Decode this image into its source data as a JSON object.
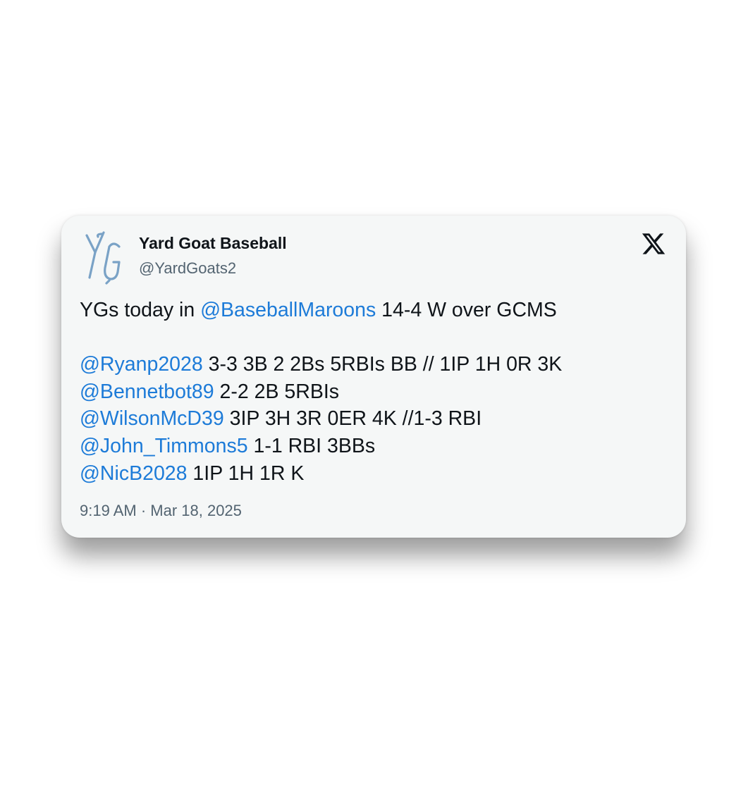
{
  "tweet": {
    "display_name": "Yard Goat Baseball",
    "handle": "@YardGoats2",
    "avatar_icon": "yg-logo",
    "platform_icon": "x-logo-icon",
    "accent_color": "#1d7bd8",
    "lines": [
      {
        "segments": [
          {
            "text": "YGs today in ",
            "mention": false
          },
          {
            "text": "@BaseballMaroons",
            "mention": true
          },
          {
            "text": " 14-4 W over GCMS",
            "mention": false
          }
        ]
      },
      {
        "segments": []
      },
      {
        "segments": [
          {
            "text": "@Ryanp2028",
            "mention": true
          },
          {
            "text": " 3-3 3B 2 2Bs 5RBIs BB // 1IP 1H 0R 3K",
            "mention": false
          }
        ]
      },
      {
        "segments": [
          {
            "text": "@Bennetbot89",
            "mention": true
          },
          {
            "text": " 2-2 2B 5RBIs",
            "mention": false
          }
        ]
      },
      {
        "segments": [
          {
            "text": "@WilsonMcD39",
            "mention": true
          },
          {
            "text": " 3IP 3H 3R 0ER 4K //1-3 RBI",
            "mention": false
          }
        ]
      },
      {
        "segments": [
          {
            "text": "@John_Timmons5",
            "mention": true
          },
          {
            "text": " 1-1 RBI 3BBs",
            "mention": false
          }
        ]
      },
      {
        "segments": [
          {
            "text": "@NicB2028",
            "mention": true
          },
          {
            "text": " 1IP 1H 1R K",
            "mention": false
          }
        ]
      }
    ],
    "timestamp": "9:19 AM · Mar 18, 2025"
  }
}
